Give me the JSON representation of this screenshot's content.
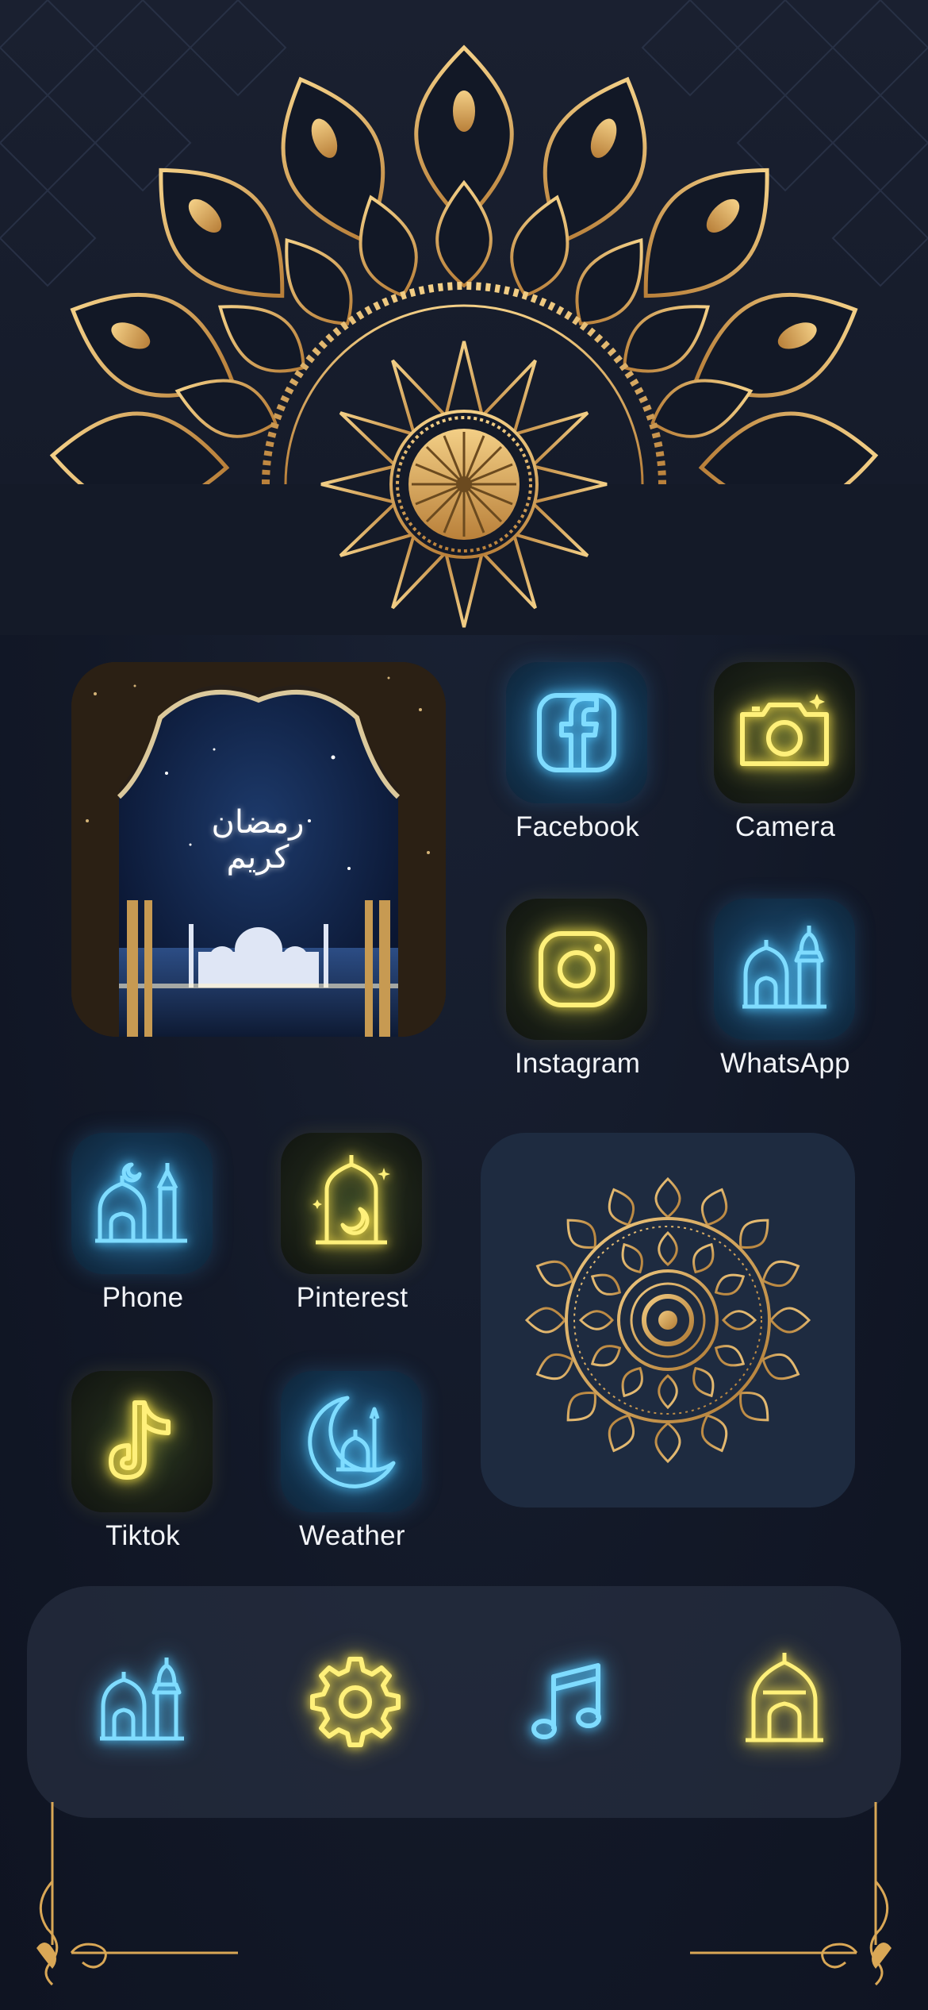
{
  "theme": {
    "background": "#131a29",
    "accent_gold": "#d9a756",
    "neon_blue": "#6fd6ff",
    "neon_yellow": "#ffec5c",
    "dock_background": "#2e3648"
  },
  "header": {
    "decoration": "gold-mandala-header"
  },
  "widgets": {
    "ramadan_photo": {
      "calligraphy_line1": "رمضان",
      "calligraphy_line2": "كريم",
      "icon": "mosque-arch-photo"
    },
    "mandala_photo": {
      "icon": "gold-mandala-photo"
    }
  },
  "apps": [
    {
      "label": "Facebook",
      "icon": "facebook-icon",
      "style": "blue"
    },
    {
      "label": "Camera",
      "icon": "camera-icon",
      "style": "yellow"
    },
    {
      "label": "Instagram",
      "icon": "instagram-icon",
      "style": "yellow"
    },
    {
      "label": "WhatsApp",
      "icon": "mosque-icon",
      "style": "blue"
    },
    {
      "label": "Phone",
      "icon": "mosque-icon",
      "style": "blue"
    },
    {
      "label": "Pinterest",
      "icon": "lantern-icon",
      "style": "yellow"
    },
    {
      "label": "Tiktok",
      "icon": "tiktok-icon",
      "style": "yellow"
    },
    {
      "label": "Weather",
      "icon": "crescent-mosque-icon",
      "style": "blue"
    }
  ],
  "dock": [
    {
      "icon": "mosque-icon",
      "style": "blue"
    },
    {
      "icon": "gear-icon",
      "style": "yellow"
    },
    {
      "icon": "music-note-icon",
      "style": "blue"
    },
    {
      "icon": "mosque-dome-icon",
      "style": "yellow"
    }
  ],
  "footer": {
    "decoration": "gold-corner-ornaments"
  }
}
